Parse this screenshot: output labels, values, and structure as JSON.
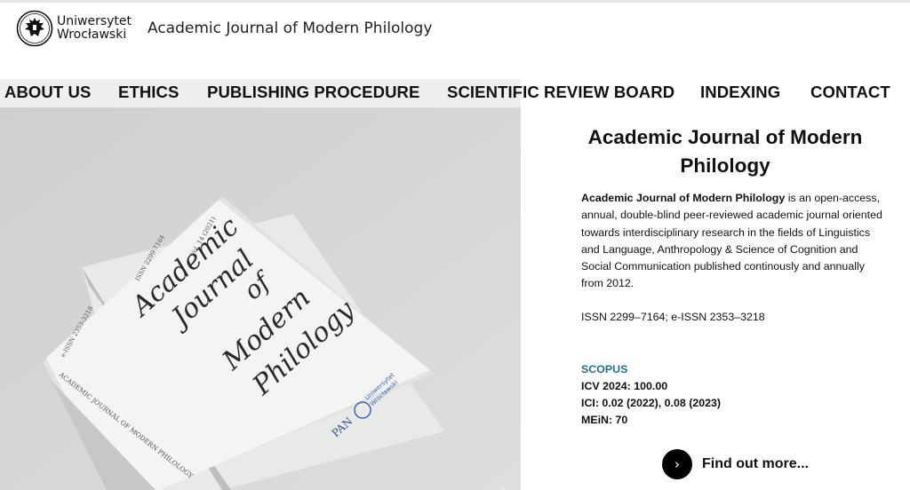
{
  "header": {
    "logo_line1": "Uniwersytet",
    "logo_line2": "Wrocławski",
    "site_title": "Academic Journal of Modern Philology"
  },
  "nav": {
    "items": [
      "ABOUT US",
      "ETHICS",
      "PUBLISHING PROCEDURE",
      "SCIENTIFIC REVIEW BOARD",
      "INDEXING",
      "CONTACT"
    ]
  },
  "hero": {
    "cover_title_1": "Academic",
    "cover_title_2": "Journal",
    "cover_title_3": "of",
    "cover_title_4": "Modern",
    "cover_title_5": "Philology",
    "cover_issn": "ISSN 2299-7164",
    "cover_eissn": "e-ISSN 2353-3218",
    "cover_vol": "Vol. 14 (2021)",
    "cover_spine": "ACADEMIC JOURNAL OF MODERN PHILOLOGY",
    "cover_pan": "PAN",
    "cover_univ_1": "Uniwersytet",
    "cover_univ_2": "Wrocławski",
    "next_arrow": "›"
  },
  "info": {
    "title": "Academic Journal of Modern Philology",
    "desc_bold": "Academic Journal of Modern Philology",
    "desc_rest": " is an open-access, annual, double-blind peer-reviewed academic journal oriented towards interdisciplinary research in the fields of Linguistics and Language, Anthropology & Science of Cognition and Social Communication published continously and annually from 2012.",
    "issn": "ISSN 2299–7164; e-ISSN 2353–3218",
    "scopus": "SCOPUS",
    "icv": "ICV 2024: 100.00",
    "ici": "ICI: 0.02 (2022), 0.08 (2023)",
    "mein": "MEiN: 70",
    "more_icon": "›",
    "more_label": "Find out more..."
  },
  "colors": {
    "accent": "#1f6f96",
    "nav_bg": "#efefef",
    "button": "#000000"
  }
}
